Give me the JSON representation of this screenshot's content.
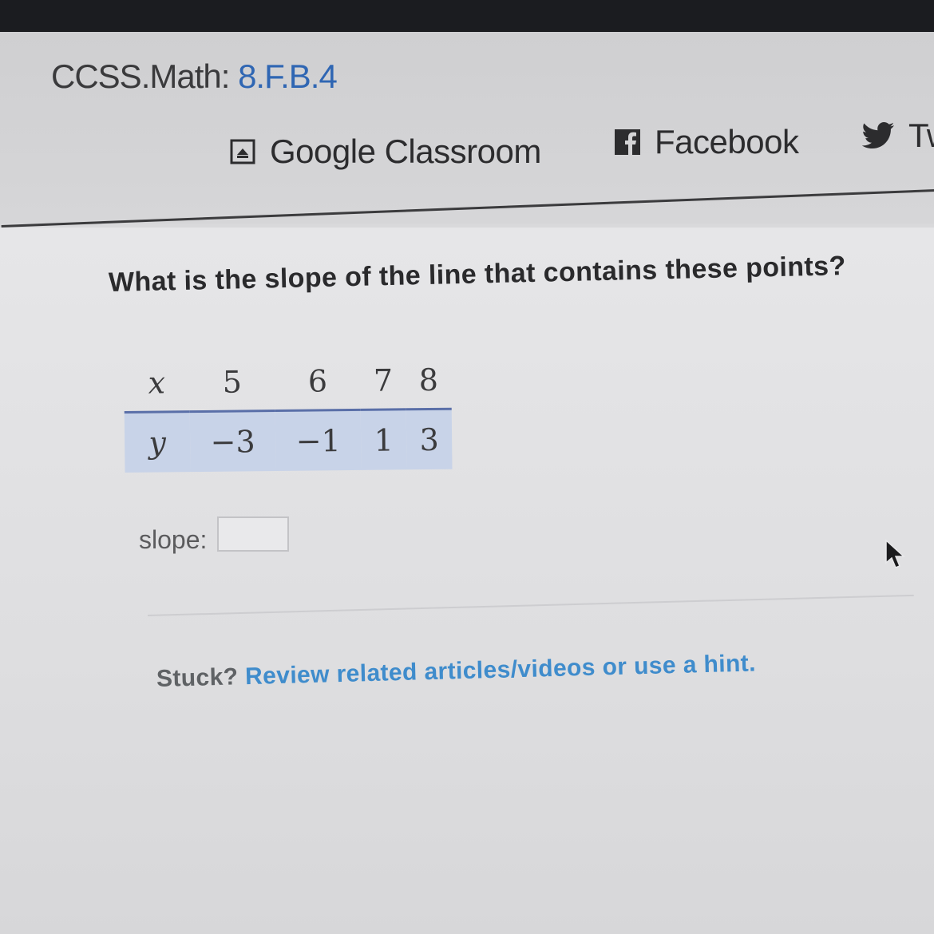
{
  "standard": {
    "prefix": "CCSS.Math: ",
    "code": "8.F.B.4"
  },
  "share": {
    "google_classroom": "Google Classroom",
    "facebook": "Facebook",
    "twitter": "Tw"
  },
  "icons": {
    "google_classroom": "google-classroom-icon",
    "facebook": "facebook-icon",
    "twitter": "twitter-icon",
    "cursor": "mouse-cursor-icon"
  },
  "question": "What is the slope of the line that contains these points?",
  "table": {
    "x_label": "x",
    "y_label": "y",
    "x_values": [
      "5",
      "6",
      "7",
      "8"
    ],
    "y_values": [
      "−3",
      "−1",
      "1",
      "3"
    ]
  },
  "answer": {
    "label": "slope:",
    "value": "",
    "placeholder": ""
  },
  "hint": {
    "prefix": "Stuck? ",
    "link": "Review related articles/videos or use a hint."
  },
  "colors": {
    "link_blue": "#3f8ccc",
    "standard_code_blue": "#2f66b3",
    "table_row_highlight": "#c8d3e8",
    "top_bar": "#1b1c20"
  }
}
